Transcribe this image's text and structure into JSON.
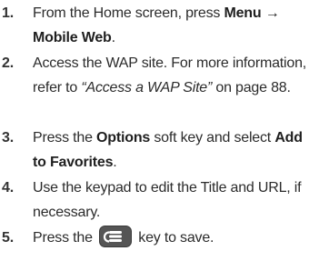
{
  "steps": [
    {
      "number": "1.",
      "t1": "From the Home screen, press ",
      "menu": "Menu",
      "arrow": "→",
      "mobile_web": "Mobile Web",
      "t2": "."
    },
    {
      "number": "2.",
      "t1": "Access the WAP site. For more information, refer to ",
      "ref": "“Access a WAP Site”",
      "t2": " on page 88."
    },
    {
      "number": "3.",
      "t1": "Press the ",
      "options": "Options",
      "t2": " soft key and select ",
      "add_fav": "Add to Favorites",
      "t3": "."
    },
    {
      "number": "4.",
      "t1": "Use the keypad to edit the Title and URL, if necessary."
    },
    {
      "number": "5.",
      "t1": "Press the ",
      "key_icon": "save-key-icon",
      "t2": " key to save."
    }
  ]
}
